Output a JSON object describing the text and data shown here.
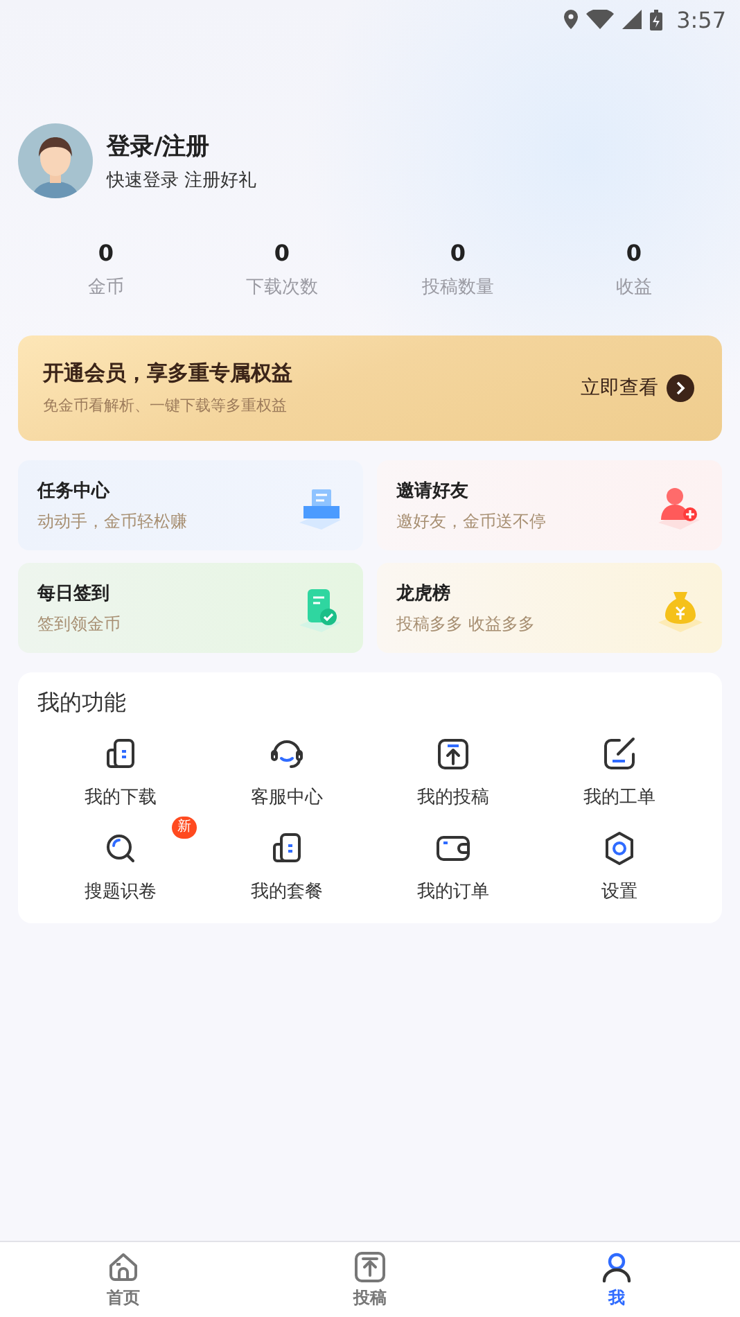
{
  "status_bar": {
    "time": "3:57"
  },
  "profile": {
    "name": "登录/注册",
    "subtitle": "快速登录 注册好礼"
  },
  "stats": [
    {
      "value": "0",
      "label": "金币"
    },
    {
      "value": "0",
      "label": "下载次数"
    },
    {
      "value": "0",
      "label": "投稿数量"
    },
    {
      "value": "0",
      "label": "收益"
    }
  ],
  "vip_banner": {
    "title": "开通会员，享多重专属权益",
    "subtitle": "免金币看解析、一键下载等多重权益",
    "action": "立即查看"
  },
  "cards": [
    {
      "title": "任务中心",
      "subtitle": "动动手，金币轻松赚",
      "kind": "task"
    },
    {
      "title": "邀请好友",
      "subtitle": "邀好友，金币送不停",
      "kind": "invite"
    },
    {
      "title": "每日签到",
      "subtitle": "签到领金币",
      "kind": "checkin"
    },
    {
      "title": "龙虎榜",
      "subtitle": "投稿多多 收益多多",
      "kind": "rank"
    }
  ],
  "functions": {
    "title": "我的功能",
    "items": [
      {
        "label": "我的下载",
        "kind": "document"
      },
      {
        "label": "客服中心",
        "kind": "headset"
      },
      {
        "label": "我的投稿",
        "kind": "upload"
      },
      {
        "label": "我的工单",
        "kind": "edit"
      },
      {
        "label": "搜题识卷",
        "kind": "search",
        "badge": "新"
      },
      {
        "label": "我的套餐",
        "kind": "document"
      },
      {
        "label": "我的订单",
        "kind": "wallet"
      },
      {
        "label": "设置",
        "kind": "settings"
      }
    ]
  },
  "tab_bar": [
    {
      "label": "首页",
      "kind": "home",
      "selected": false
    },
    {
      "label": "投稿",
      "kind": "upload",
      "selected": false
    },
    {
      "label": "我",
      "kind": "user",
      "selected": true
    }
  ]
}
